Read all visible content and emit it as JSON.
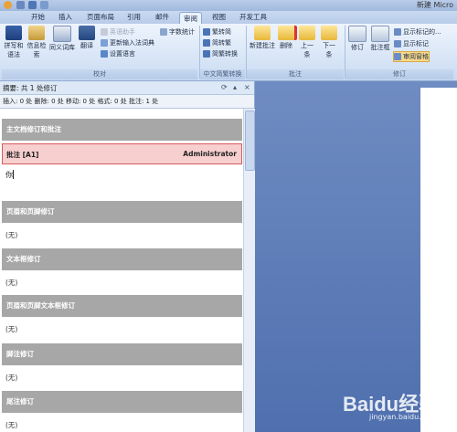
{
  "window": {
    "title": "新建 Micro"
  },
  "tabs": [
    "开始",
    "插入",
    "页面布局",
    "引用",
    "邮件",
    "审阅",
    "视图",
    "开发工具"
  ],
  "ribbon": {
    "groups": {
      "proofing": {
        "label": "校对",
        "spell_check": "拼写和语法",
        "research": "信息检索",
        "thesaurus": "同义词库",
        "translate": "翻译",
        "translate_tip": "英语助手",
        "update_ime": "更新输入法词典",
        "set_language": "设置语言",
        "word_count": "字数统计"
      },
      "chinese_conversion": {
        "label": "中文简繁转换",
        "to_traditional": "繁转简",
        "to_simplified": "简转繁",
        "conversion": "简繁转换"
      },
      "comments": {
        "label": "批注",
        "new_comment": "新建批注",
        "delete": "删除",
        "previous": "上一条",
        "next": "下一条"
      },
      "tracking": {
        "label": "修订",
        "track_changes": "修订",
        "balloons": "批注框",
        "show_markup": "显示标记的...",
        "show_markup_menu": "显示标记",
        "reviewing_pane": "审阅窗格"
      }
    }
  },
  "pane": {
    "summary": "摘要: 共 1 处修订",
    "counts": "插入: 0 处 删除: 0 处 移动: 0 处 格式: 0 处 批注: 1 处",
    "sections": {
      "main": "主文档修订和批注",
      "header_footer": "页眉和页脚修订",
      "textbox": "文本框修订",
      "header_footer_textbox": "页眉和页脚文本框修订",
      "footnote": "脚注修订",
      "endnote": "尾注修订"
    },
    "none_text": "(无)",
    "comment": {
      "label": "批注 [A1]",
      "author": "Administrator",
      "text": "你"
    }
  },
  "watermark": {
    "logo": "Baidu经验",
    "url": "jingyan.baidu.com"
  }
}
